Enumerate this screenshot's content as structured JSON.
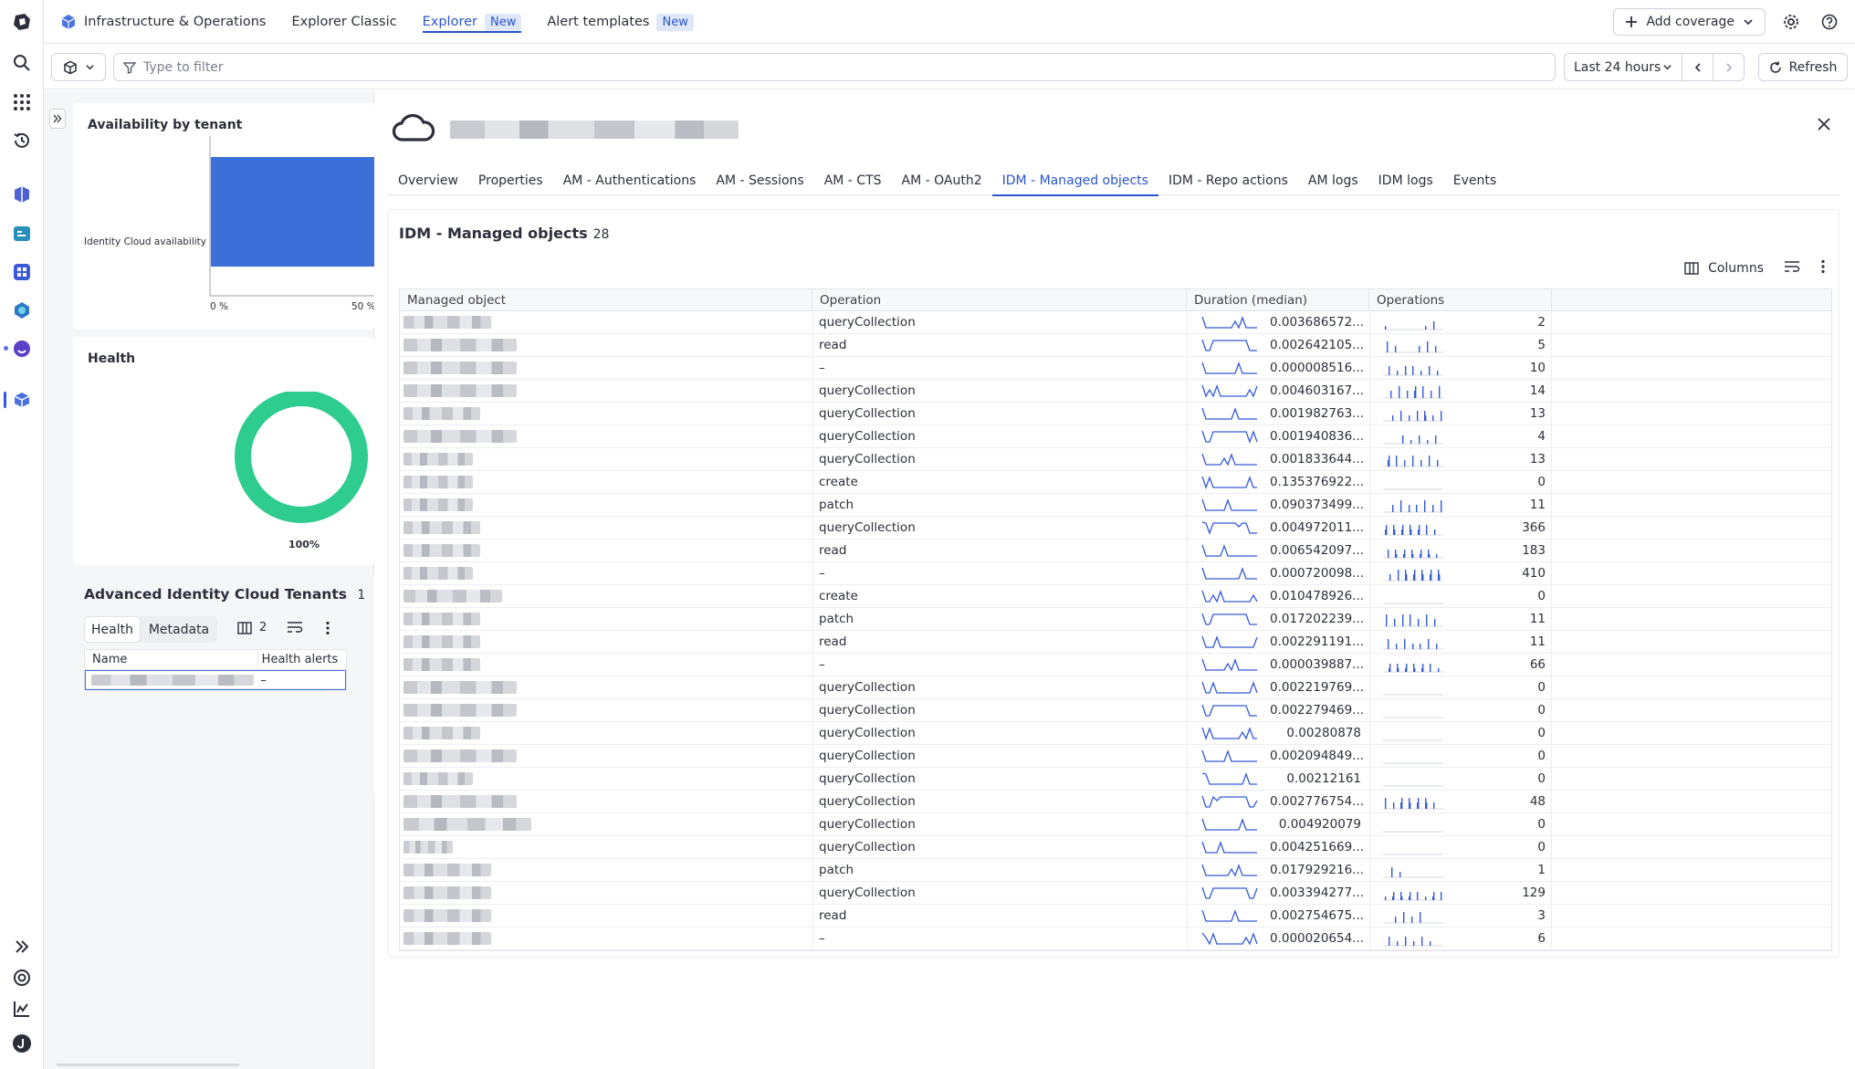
{
  "appnav": {
    "app_title": "Infrastructure & Operations",
    "explorer_classic": "Explorer Classic",
    "explorer": "Explorer",
    "explorer_badge": "New",
    "alert_templates": "Alert templates",
    "alert_badge": "New"
  },
  "topright": {
    "add_coverage": "Add coverage"
  },
  "filterbar": {
    "placeholder": "Type to filter",
    "timeframe": "Last 24 hours",
    "refresh": "Refresh"
  },
  "left": {
    "availability_title": "Availability by tenant",
    "availability_series": "Identity Cloud availability",
    "availability_ticks": [
      "0 %",
      "50 %"
    ],
    "health_title": "Health",
    "health_value": "100%",
    "tenants_title": "Advanced Identity Cloud Tenants",
    "tenants_count": "1",
    "tab_health": "Health",
    "tab_metadata": "Metadata",
    "columns_count": "2",
    "col_name": "Name",
    "col_alerts": "Health alerts",
    "alert_value": "–"
  },
  "detail": {
    "tabs": [
      "Overview",
      "Properties",
      "AM - Authentications",
      "AM - Sessions",
      "AM - CTS",
      "AM - OAuth2",
      "IDM - Managed objects",
      "IDM - Repo actions",
      "AM logs",
      "IDM logs",
      "Events"
    ],
    "active_tab": 6,
    "section_title": "IDM - Managed objects",
    "section_count": "28",
    "columns_label": "Columns",
    "headers": [
      "Managed object",
      "Operation",
      "Duration (median)",
      "Operations"
    ],
    "rows": [
      {
        "op": "queryCollection",
        "dur": "0.003686572...",
        "ops": "2"
      },
      {
        "op": "read",
        "dur": "0.002642105...",
        "ops": "5"
      },
      {
        "op": "–",
        "dur": "0.000008516...",
        "ops": "10"
      },
      {
        "op": "queryCollection",
        "dur": "0.004603167...",
        "ops": "14"
      },
      {
        "op": "queryCollection",
        "dur": "0.001982763...",
        "ops": "13"
      },
      {
        "op": "queryCollection",
        "dur": "0.001940836...",
        "ops": "4"
      },
      {
        "op": "queryCollection",
        "dur": "0.001833644...",
        "ops": "13"
      },
      {
        "op": "create",
        "dur": "0.135376922...",
        "ops": "0"
      },
      {
        "op": "patch",
        "dur": "0.090373499...",
        "ops": "11"
      },
      {
        "op": "queryCollection",
        "dur": "0.004972011...",
        "ops": "366"
      },
      {
        "op": "read",
        "dur": "0.006542097...",
        "ops": "183"
      },
      {
        "op": "–",
        "dur": "0.000720098...",
        "ops": "410"
      },
      {
        "op": "create",
        "dur": "0.010478926...",
        "ops": "0"
      },
      {
        "op": "patch",
        "dur": "0.017202239...",
        "ops": "11"
      },
      {
        "op": "read",
        "dur": "0.002291191...",
        "ops": "11"
      },
      {
        "op": "–",
        "dur": "0.000039887...",
        "ops": "66"
      },
      {
        "op": "queryCollection",
        "dur": "0.002219769...",
        "ops": "0"
      },
      {
        "op": "queryCollection",
        "dur": "0.002279469...",
        "ops": "0"
      },
      {
        "op": "queryCollection",
        "dur": "0.00280878",
        "ops": "0"
      },
      {
        "op": "queryCollection",
        "dur": "0.002094849...",
        "ops": "0"
      },
      {
        "op": "queryCollection",
        "dur": "0.00212161",
        "ops": "0"
      },
      {
        "op": "queryCollection",
        "dur": "0.002776754...",
        "ops": "48"
      },
      {
        "op": "queryCollection",
        "dur": "0.004920079",
        "ops": "0"
      },
      {
        "op": "queryCollection",
        "dur": "0.004251669...",
        "ops": "0"
      },
      {
        "op": "patch",
        "dur": "0.017929216...",
        "ops": "1"
      },
      {
        "op": "queryCollection",
        "dur": "0.003394277...",
        "ops": "129"
      },
      {
        "op": "read",
        "dur": "0.002754675...",
        "ops": "3"
      },
      {
        "op": "–",
        "dur": "0.000020654...",
        "ops": "6"
      }
    ]
  },
  "colors": {
    "accent": "#2a55c9",
    "bar": "#3d6fd8",
    "donut": "#2ecc8e",
    "spark": "#3559d8"
  },
  "icons": [
    "dynatrace-logo-icon",
    "search-icon",
    "apps-grid-icon",
    "history-icon",
    "settings-gear-icon",
    "help-icon",
    "cloud-icon",
    "close-icon",
    "filter-icon",
    "columns-icon",
    "chevron-down-icon"
  ]
}
